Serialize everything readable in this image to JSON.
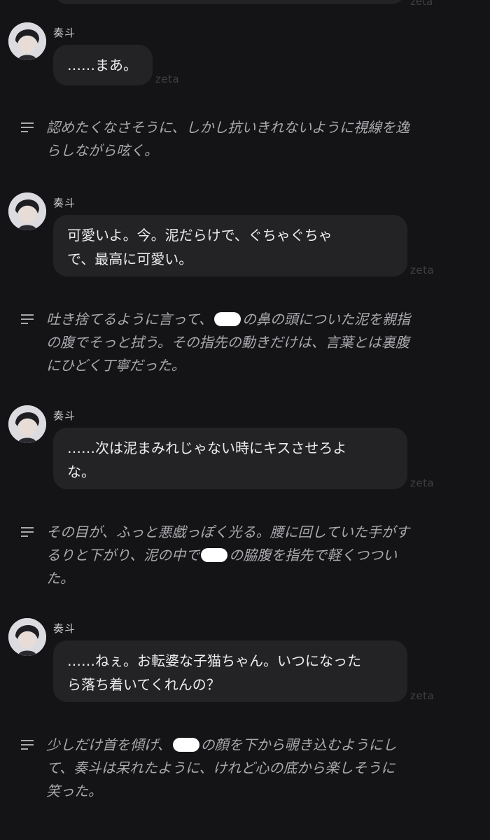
{
  "watermark": "zeta",
  "speaker": "奏斗",
  "messages": [
    {
      "text": "……まあ。"
    },
    {
      "text": "可愛いよ。今。泥だらけで、ぐちゃぐちゃ\nで、最高に可愛い。"
    },
    {
      "text": "……次は泥まみれじゃない時にキスさせろよ\nな。"
    },
    {
      "text": "……ねぇ。お転婆な子猫ちゃん。いつになった\nら落ち着いてくれんの？"
    }
  ],
  "narrations": [
    {
      "line1": "認めたくなさそうに、しかし抗いきれないように視線を逸",
      "line2": "らしながら呟く。"
    },
    {
      "line1_a": "吐き捨てるように言って、",
      "line1_b": "の鼻の頭についた泥を親指",
      "line2": "の腹でそっと拭う。その指先の動きだけは、言葉とは裏腹",
      "line3": "にひどく丁寧だった。"
    },
    {
      "line1": "その目が、ふっと悪戯っぽく光る。腰に回していた手がす",
      "line2_a": "るりと下がり、泥の中で",
      "line2_b": "の脇腹を指先で軽くつつい",
      "line3": "た。"
    },
    {
      "line1_a": "少しだけ首を傾げ、",
      "line1_b": "の顔を下から覗き込むようにし",
      "line2": "て、奏斗は呆れたように、けれど心の底から楽しそうに",
      "line3": "笑った。"
    }
  ]
}
